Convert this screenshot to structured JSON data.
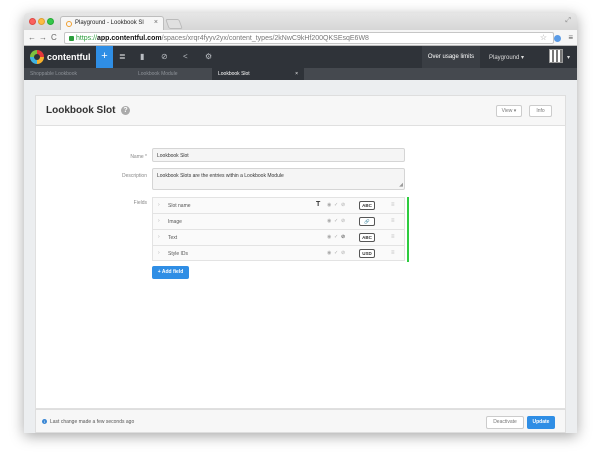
{
  "browser": {
    "tab_title": "Playground - Lookbook Sl",
    "tab_close": "×",
    "url_scheme": "https://",
    "url_host": "app.contentful.com",
    "url_path": "/spaces/xrqr4fyyv2yx/content_types/2kNwC9kHf200QKSEsqE6W8",
    "nav_back": "←",
    "nav_forward": "→",
    "nav_reload": "C",
    "star": "☆",
    "menu": "≡"
  },
  "header": {
    "brand": "contentful",
    "plus": "+",
    "usage_label": "Over usage limits",
    "space_label": "Playground ▾",
    "avatar_caret": "▾"
  },
  "entity_tabs": [
    {
      "label": "Shoppable Lookbook"
    },
    {
      "label": "Lookbook Module"
    },
    {
      "label": "Lookbook Slot",
      "close": "×"
    }
  ],
  "page": {
    "title": "Lookbook Slot",
    "help": "?",
    "view_button": "View ▾",
    "info_button": "Info"
  },
  "form": {
    "name_label": "Name *",
    "name_value": "Lookbook Slot",
    "description_label": "Description",
    "description_value": "Lookbook Slots are the entries within a Lookbook Module",
    "fields_label": "Fields",
    "fields": [
      {
        "name": "Slot name",
        "title": "T",
        "type_badge": "ABC",
        "disabled_dark": false
      },
      {
        "name": "Image",
        "title": "",
        "type_badge": "🔗",
        "disabled_dark": false
      },
      {
        "name": "Text",
        "title": "",
        "type_badge": "ABC",
        "disabled_dark": true
      },
      {
        "name": "Style IDs",
        "title": "",
        "type_badge": "USD",
        "disabled_dark": false
      }
    ],
    "add_field": "+ Add field"
  },
  "footer": {
    "info": "i",
    "last_change": "Last change made a few seconds ago",
    "deactivate": "Deactivate",
    "update": "Update"
  }
}
